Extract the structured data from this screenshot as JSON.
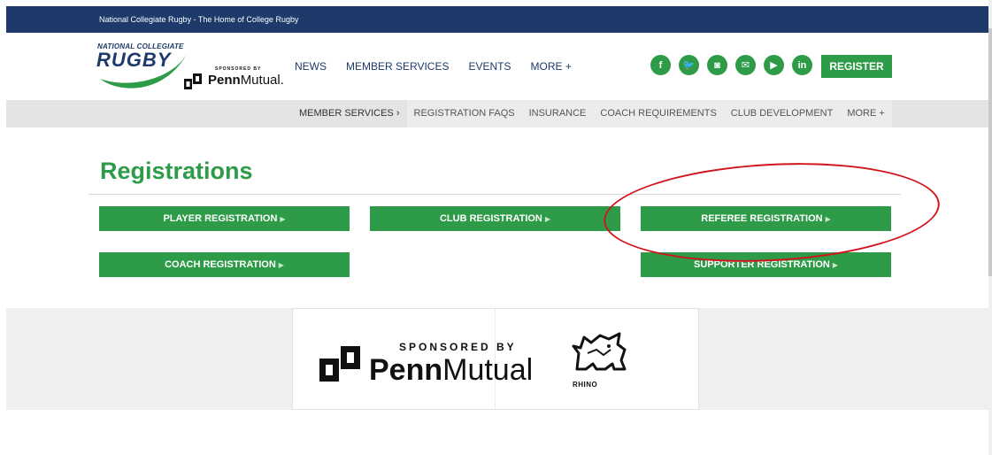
{
  "topbar": {
    "text": "National Collegiate Rugby - The Home of College Rugby"
  },
  "logo": {
    "line1": "NATIONAL COLLEGIATE",
    "line2": "RUGBY",
    "sponsored": "SPONSORED BY",
    "penn_bold": "Penn",
    "penn_light": "Mutual."
  },
  "mainnav": {
    "items": [
      "NEWS",
      "MEMBER SERVICES",
      "EVENTS",
      "MORE +"
    ]
  },
  "social": {
    "icons": [
      {
        "name": "facebook-icon",
        "glyph": "f"
      },
      {
        "name": "twitter-icon",
        "glyph": "🐦"
      },
      {
        "name": "instagram-icon",
        "glyph": "◙"
      },
      {
        "name": "email-icon",
        "glyph": "✉"
      },
      {
        "name": "youtube-icon",
        "glyph": "▶"
      },
      {
        "name": "linkedin-icon",
        "glyph": "in"
      }
    ]
  },
  "register": {
    "label": "REGISTER"
  },
  "subnav": {
    "items": [
      "MEMBER SERVICES  ›",
      "REGISTRATION FAQS",
      "INSURANCE",
      "COACH REQUIREMENTS",
      "CLUB DEVELOPMENT",
      "MORE +"
    ]
  },
  "main": {
    "title": "Registrations",
    "buttons": {
      "player": "PLAYER REGISTRATION",
      "club": "CLUB REGISTRATION",
      "referee": "REFEREE REGISTRATION",
      "coach": "COACH REGISTRATION",
      "supporter": "SUPPORTER REGISTRATION"
    },
    "arrow": "▶"
  },
  "sponsor": {
    "sponsored": "SPONSORED BY",
    "penn_bold": "Penn",
    "penn_light": "Mutual",
    "rhino": "RHINO"
  },
  "colors": {
    "navy": "#1d3a6b",
    "green": "#2e9b48",
    "highlight": "#d0141b"
  }
}
